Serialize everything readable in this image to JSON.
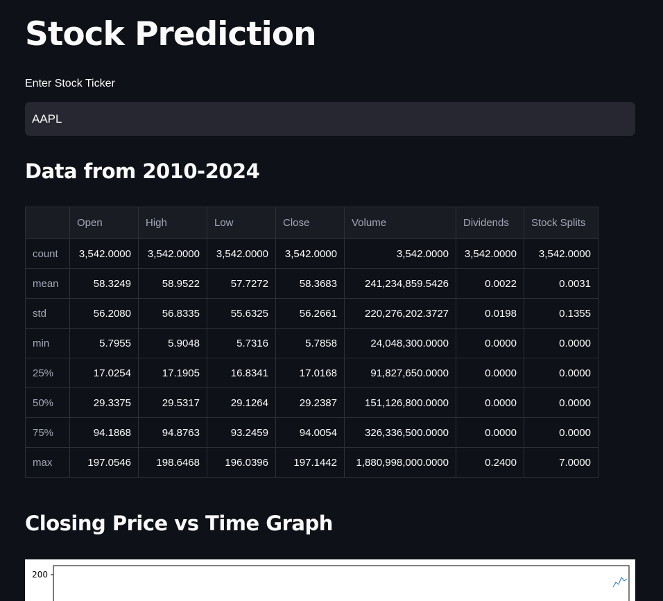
{
  "page": {
    "title": "Stock Prediction",
    "ticker_label": "Enter Stock Ticker",
    "ticker_value": "AAPL",
    "data_heading": "Data from 2010-2024",
    "graph_heading": "Closing Price vs Time Graph"
  },
  "table": {
    "columns": [
      "",
      "Open",
      "High",
      "Low",
      "Close",
      "Volume",
      "Dividends",
      "Stock Splits"
    ],
    "rows": [
      {
        "stat": "count",
        "values": [
          "3,542.0000",
          "3,542.0000",
          "3,542.0000",
          "3,542.0000",
          "3,542.0000",
          "3,542.0000",
          "3,542.0000"
        ]
      },
      {
        "stat": "mean",
        "values": [
          "58.3249",
          "58.9522",
          "57.7272",
          "58.3683",
          "241,234,859.5426",
          "0.0022",
          "0.0031"
        ]
      },
      {
        "stat": "std",
        "values": [
          "56.2080",
          "56.8335",
          "55.6325",
          "56.2661",
          "220,276,202.3727",
          "0.0198",
          "0.1355"
        ]
      },
      {
        "stat": "min",
        "values": [
          "5.7955",
          "5.9048",
          "5.7316",
          "5.7858",
          "24,048,300.0000",
          "0.0000",
          "0.0000"
        ]
      },
      {
        "stat": "25%",
        "values": [
          "17.0254",
          "17.1905",
          "16.8341",
          "17.0168",
          "91,827,650.0000",
          "0.0000",
          "0.0000"
        ]
      },
      {
        "stat": "50%",
        "values": [
          "29.3375",
          "29.5317",
          "29.1264",
          "29.2387",
          "151,126,800.0000",
          "0.0000",
          "0.0000"
        ]
      },
      {
        "stat": "75%",
        "values": [
          "94.1868",
          "94.8763",
          "93.2459",
          "94.0054",
          "326,336,500.0000",
          "0.0000",
          "0.0000"
        ]
      },
      {
        "stat": "max",
        "values": [
          "197.0546",
          "198.6468",
          "196.0396",
          "197.1442",
          "1,880,998,000.0000",
          "0.2400",
          "7.0000"
        ]
      }
    ]
  },
  "chart_data": {
    "type": "line",
    "title": "",
    "xlabel": "",
    "ylabel": "",
    "y_tick_labels": [
      "200"
    ],
    "series": [
      {
        "values": []
      }
    ],
    "line_color": "#1f77b4"
  }
}
